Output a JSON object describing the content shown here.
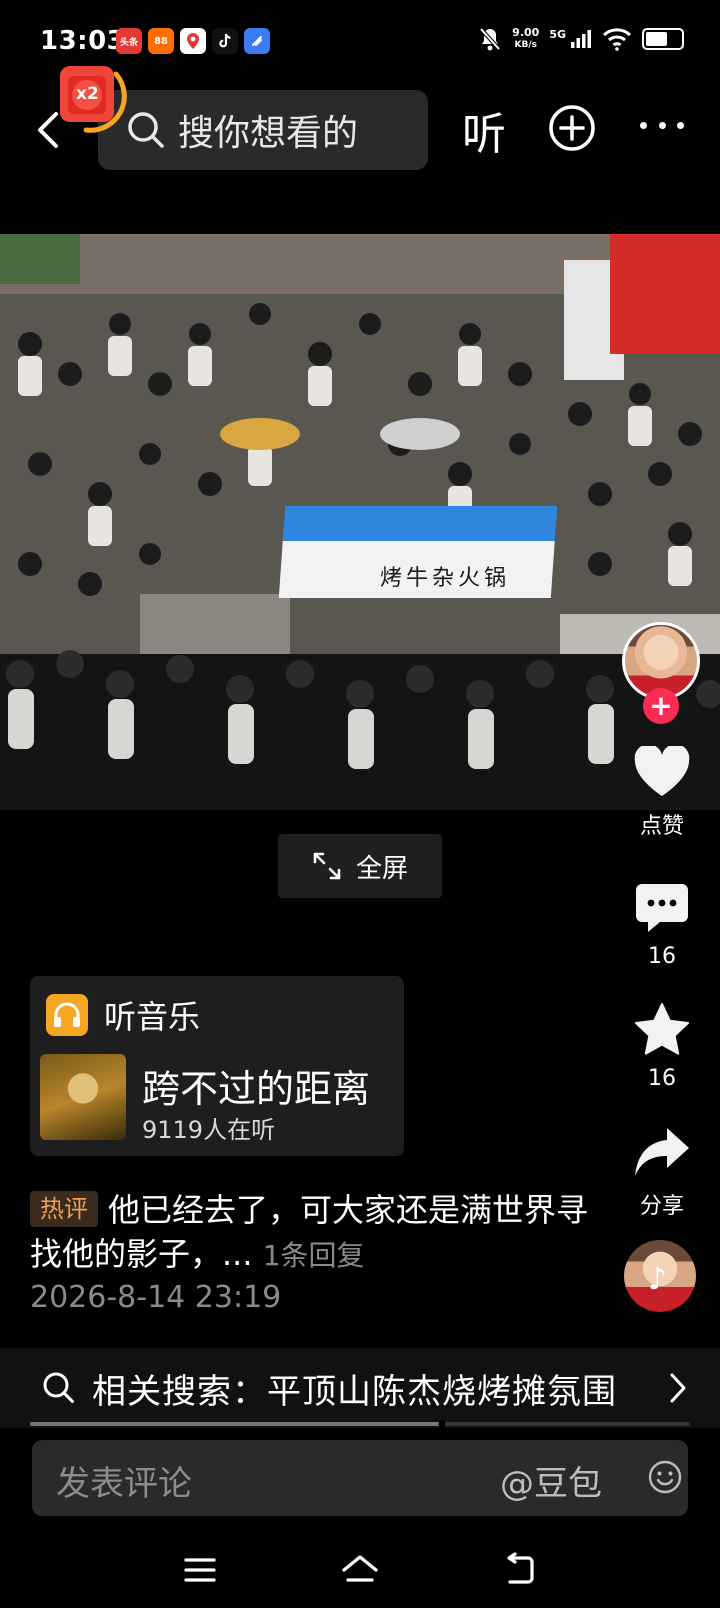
{
  "status_bar": {
    "time": "13:03",
    "apps": [
      {
        "name": "toutiao-app-icon",
        "label": "头条",
        "color": "#e53935"
      },
      {
        "name": "orange-app-icon",
        "label": "88",
        "color": "#ff6d00"
      },
      {
        "name": "red-pin-app-icon",
        "label": "",
        "color": "#ffffff"
      },
      {
        "name": "tiktok-app-icon",
        "label": "",
        "color": "#111111"
      },
      {
        "name": "blue-app-icon",
        "label": "",
        "color": "#3d7cf5"
      }
    ],
    "net_speed_value": "9.00",
    "net_speed_unit": "KB/s",
    "network_type": "5G"
  },
  "top_nav": {
    "search_placeholder": "搜你想看的",
    "listen_label": "听",
    "redpacket_label": "x2"
  },
  "video": {
    "stall_sign": "烤牛杂火锅"
  },
  "actions": {
    "like_label": "点赞",
    "comment_count": "16",
    "favorite_count": "16",
    "share_label": "分享"
  },
  "fullscreen_label": "全屏",
  "music_card": {
    "header": "听音乐",
    "song_title": "跨不过的距离",
    "listeners": "9119人在听"
  },
  "hot_comment": {
    "badge": "热评",
    "text": "他已经去了，可大家还是满世界寻找他的影子，...",
    "reply_count": "1条回复",
    "time": "2026-8-14 23:19"
  },
  "related_search": {
    "label": "相关搜索：平顶山陈杰烧烤摊氛围"
  },
  "progress": 0.62,
  "comment_bar": {
    "placeholder": "发表评论",
    "mention": "@豆包"
  },
  "colors": {
    "accent_red": "#fe2c55",
    "music_orange": "#f5a623",
    "hot_badge_text": "#f0a050"
  }
}
